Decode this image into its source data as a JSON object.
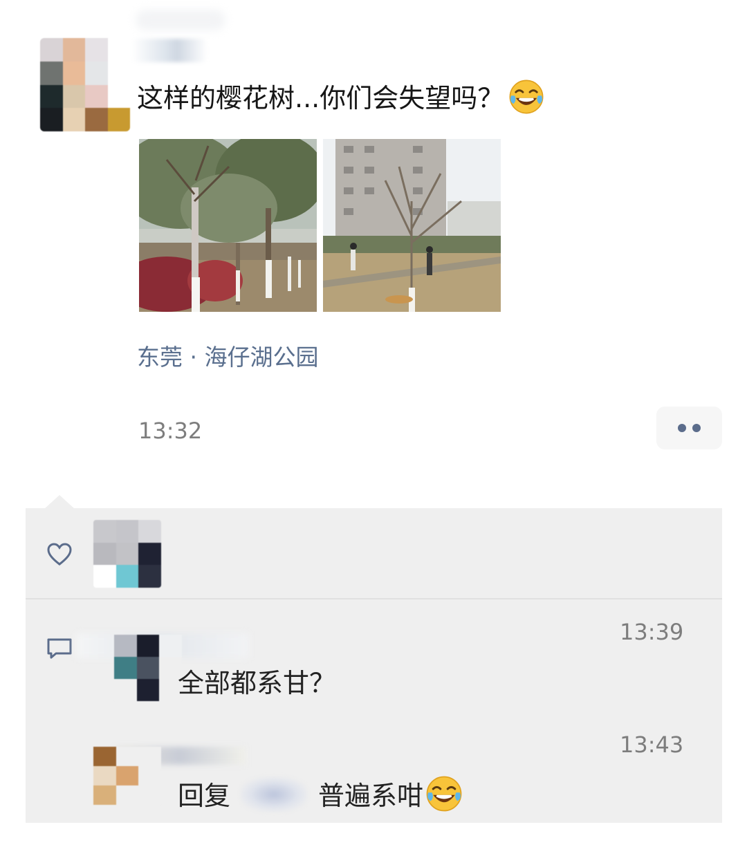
{
  "post": {
    "author_avatar": "pixelated-avatar",
    "text": "这样的樱花树...你们会失望吗？",
    "emoji": "tears-of-joy",
    "location": "东莞 · 海仔湖公园",
    "time": "13:32",
    "more_icon": "two-dots-icon"
  },
  "likes": {
    "icon": "heart-outline-icon"
  },
  "comments_icon": "comment-bubble-icon",
  "comments": [
    {
      "time": "13:39",
      "text": "全部都系甘？"
    },
    {
      "time": "13:43",
      "reply_prefix": "回复",
      "text": "普遍系咁",
      "emoji": "tears-of-joy"
    }
  ],
  "colors": {
    "link_blue": "#5a6f8e",
    "panel_bg": "#efefef",
    "timestamp_grey": "#7d7d7d"
  }
}
